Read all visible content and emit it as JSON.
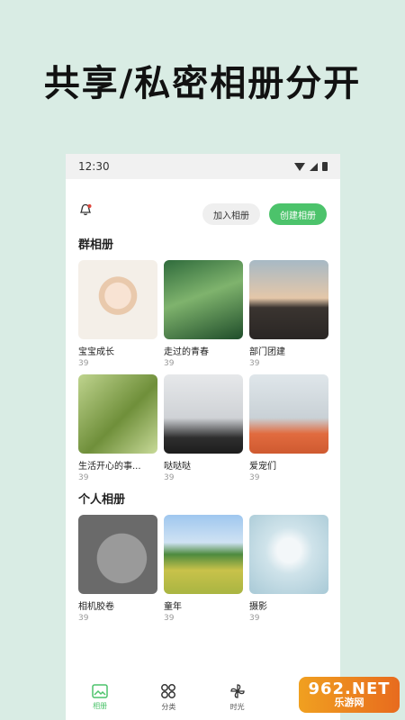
{
  "promo": {
    "headline": "共享/私密相册分开"
  },
  "status_bar": {
    "time": "12:30"
  },
  "header": {
    "join_label": "加入相册",
    "create_label": "创建相册"
  },
  "group_albums": {
    "title": "群相册",
    "items": [
      {
        "name": "宝宝成长",
        "count": "39",
        "photo": "baby-photo"
      },
      {
        "name": "走过的青春",
        "count": "39",
        "photo": "palm-girl-photo"
      },
      {
        "name": "部门团建",
        "count": "39",
        "photo": "sunset-group-photo"
      },
      {
        "name": "生活开心的事...",
        "count": "39",
        "photo": "tree-photo"
      },
      {
        "name": "哒哒哒",
        "count": "39",
        "photo": "girl-portrait-photo"
      },
      {
        "name": "爱宠们",
        "count": "39",
        "photo": "cat-photo"
      }
    ]
  },
  "personal_albums": {
    "title": "个人相册",
    "items": [
      {
        "name": "相机胶卷",
        "count": "39",
        "photo": "grey-cat-photo"
      },
      {
        "name": "童年",
        "count": "39",
        "photo": "field-photo"
      },
      {
        "name": "摄影",
        "count": "39",
        "photo": "hands-light-photo"
      }
    ]
  },
  "bottom_nav": {
    "tab1": "相册",
    "tab2": "分类",
    "tab3": "时光"
  },
  "watermark": {
    "brand": "962.NET",
    "sub": "乐游网"
  },
  "colors": {
    "accent": "#4cc36b",
    "background": "#d9ece4"
  }
}
